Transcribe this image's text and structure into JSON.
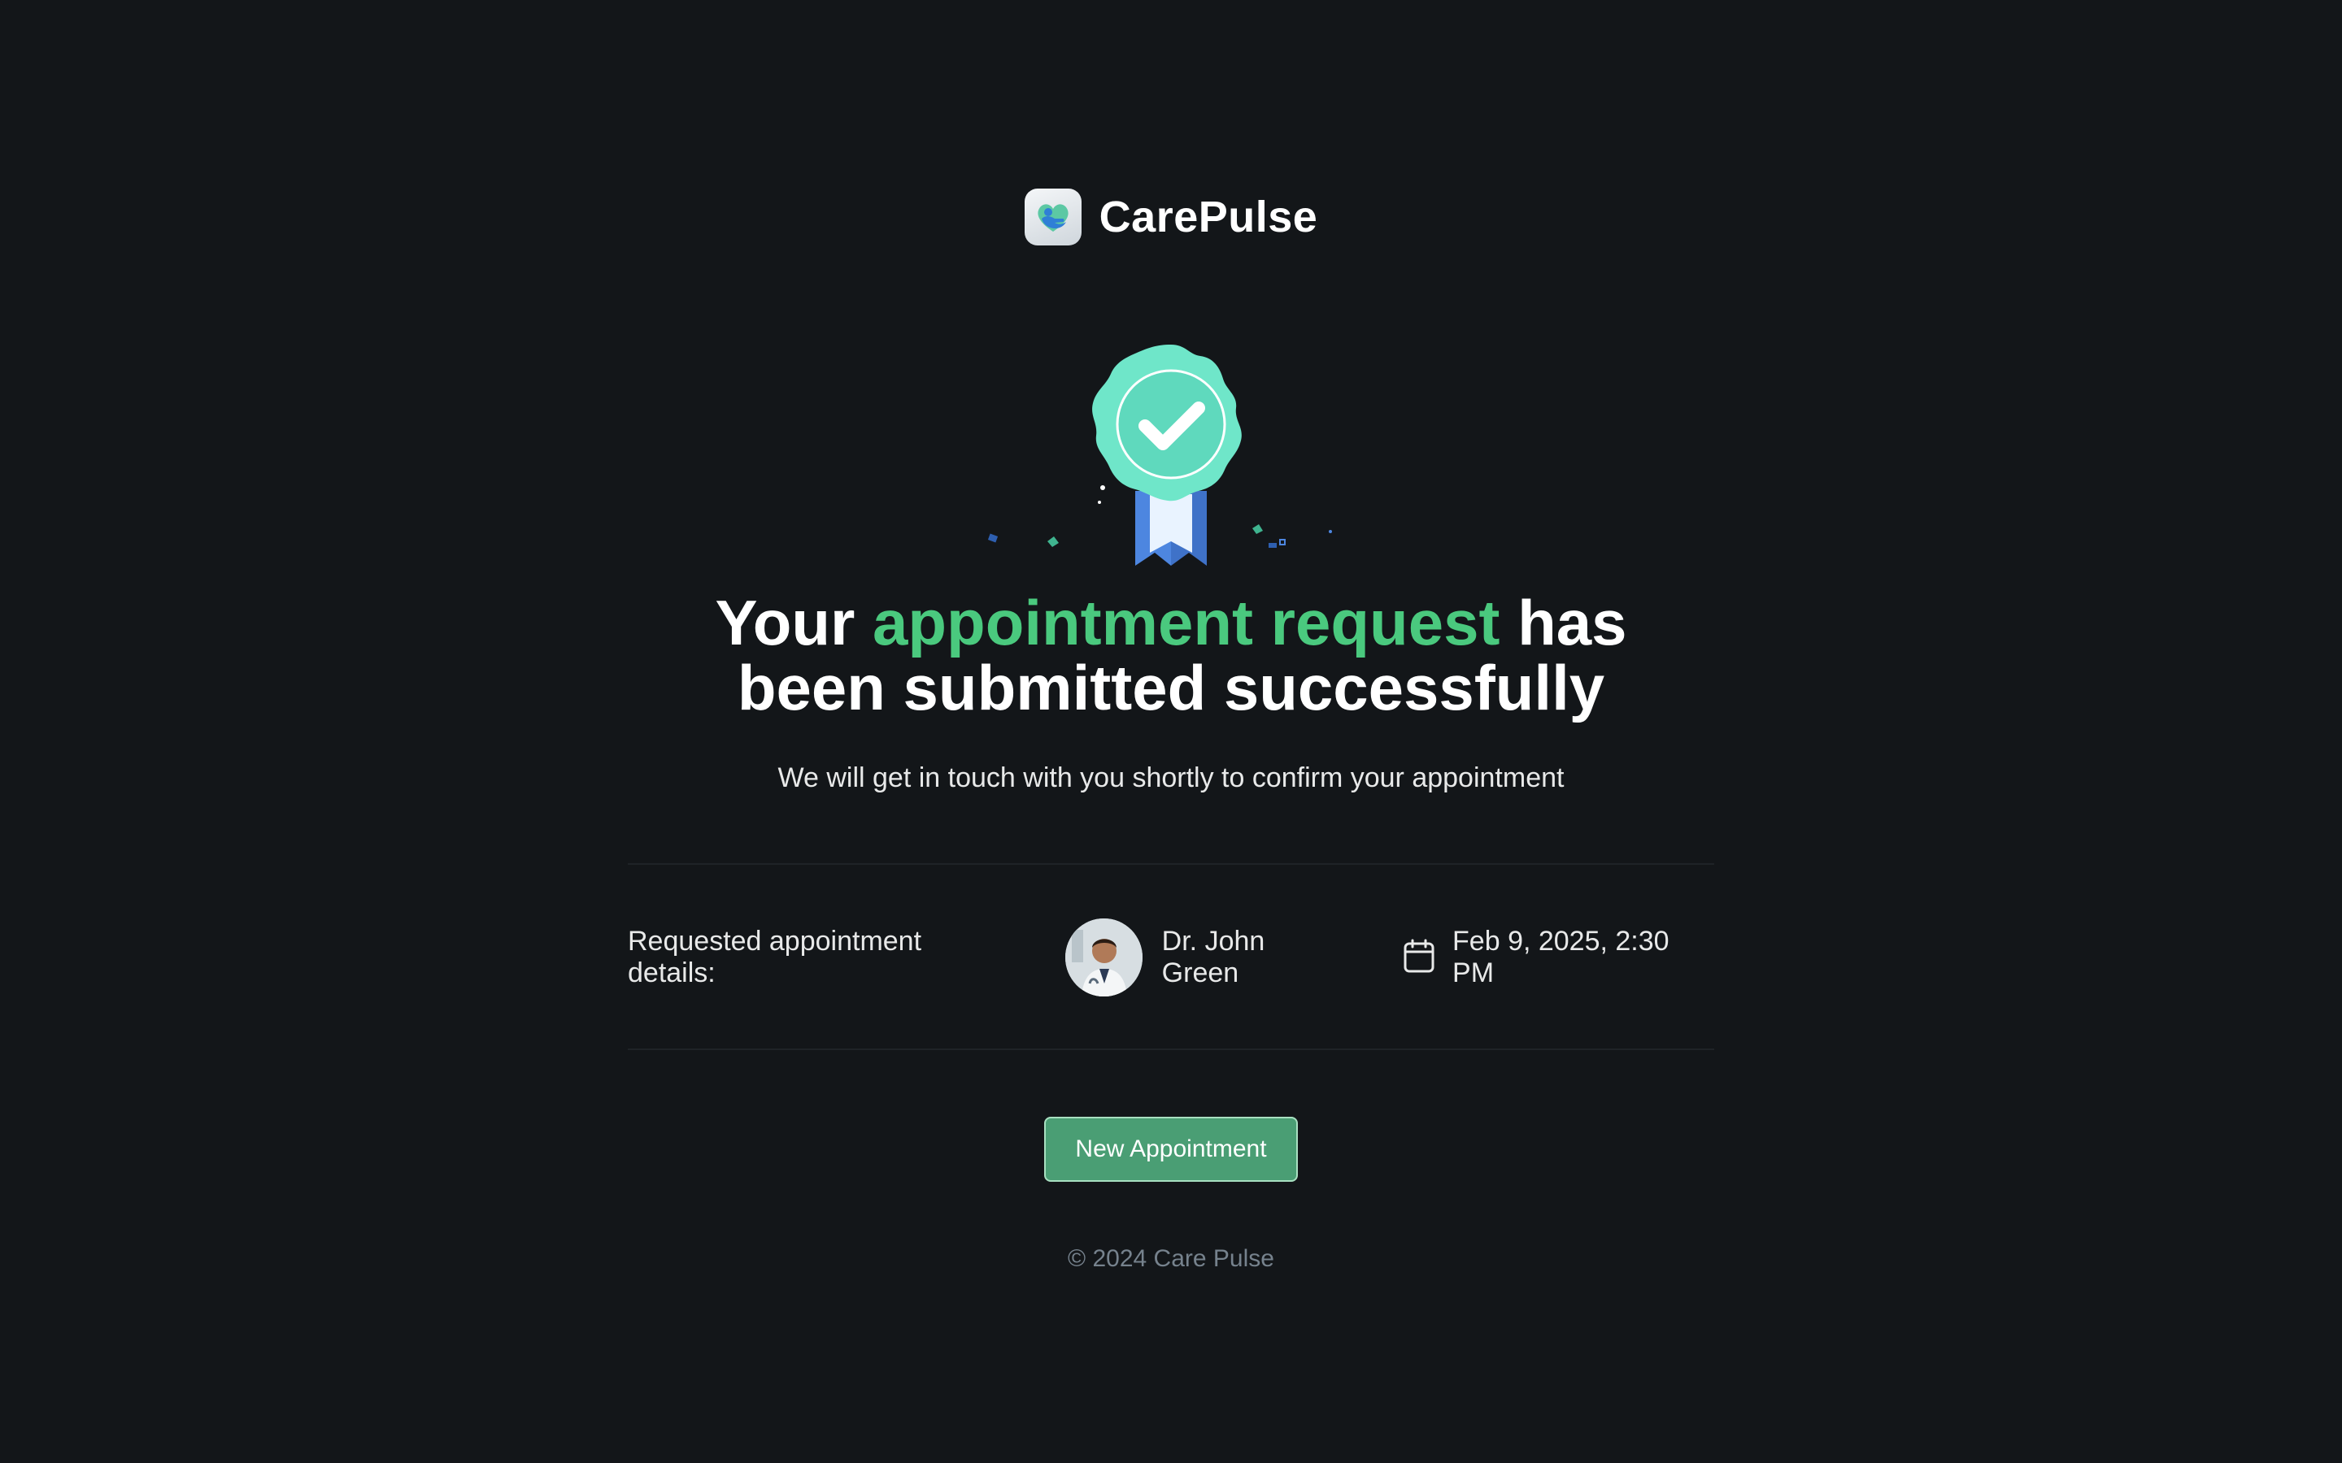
{
  "brand": {
    "name": "CarePulse",
    "logo_icon": "heart-hand-logo-icon"
  },
  "badge": {
    "icon": "success-ribbon-badge-icon",
    "colors": {
      "seal": "#6fe6c9",
      "ribbon": "#4d86e0"
    }
  },
  "headline": {
    "part1": "Your",
    "accent": "appointment request",
    "part2": "has",
    "line2": "been submitted successfully"
  },
  "subline": "We will get in touch with you shortly to confirm your appointment",
  "details": {
    "label": "Requested appointment details:",
    "doctor_name": "Dr. John Green",
    "date_icon": "calendar-icon",
    "datetime": "Feb 9, 2025, 2:30 PM"
  },
  "actions": {
    "new_appointment_label": "New Appointment"
  },
  "footer": {
    "copyright": "© 2024 Care Pulse"
  },
  "colors": {
    "background": "#131619",
    "accent": "#4ac97e",
    "button": "#4a9e74"
  }
}
